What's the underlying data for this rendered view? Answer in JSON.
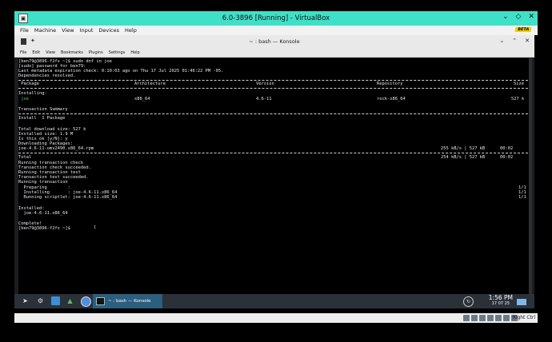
{
  "vbox": {
    "title": "6.0-3896 [Running] - VirtualBox",
    "menu": [
      "File",
      "Machine",
      "View",
      "Input",
      "Devices",
      "Help"
    ],
    "beta": "BETA",
    "host_key": "Right Ctrl"
  },
  "konsole": {
    "title": "~ : bash — Konsole",
    "menu": [
      "File",
      "Edit",
      "View",
      "Bookmarks",
      "Plugins",
      "Settings",
      "Help"
    ]
  },
  "terminal": {
    "lines": [
      "[ben79@3896-f2fs ~]$ sudo dnf in joe",
      "[sudo] password for ben79:",
      "Last metadata expiration check: 0:10:03 ago on Thu 17 Jul 2025 01:46:22 PM -05.",
      "Dependencies resolved."
    ],
    "table_header": {
      "package": " Package",
      "architecture": "Architecture",
      "version": "Version",
      "repository": "Repository",
      "size": "Size"
    },
    "installing_label": "Installing:",
    "package_row": {
      "name": " joe",
      "arch": "x86_64",
      "version": "4.6-11",
      "repo": "rock-x86_64",
      "size": "527 k"
    },
    "summary_title": "Transaction Summary",
    "install_line": "Install  1 Package",
    "lines2": [
      "Total download size: 527 k",
      "Installed size: 1.9 M",
      "Is this ok [y/N]: y",
      "Downloading Packages:"
    ],
    "download_row": {
      "file": "joe-4.6-11-omv2490.x86_64.rpm",
      "rate": "255 kB/s | 527 kB",
      "time": "00:02"
    },
    "total_row": {
      "label": "Total",
      "rate": "254 kB/s | 527 kB",
      "time": "00:02"
    },
    "lines3": [
      "Running transaction check",
      "Transaction check succeeded.",
      "Running transaction test",
      "Transaction test succeeded.",
      "Running transaction"
    ],
    "steps": [
      {
        "text": "  Preparing        :",
        "count": "1/1"
      },
      {
        "text": "  Installing       : joe-4.6-11.x86_64",
        "count": "1/1"
      },
      {
        "text": "  Running scriptlet: joe-4.6-11.x86_64",
        "count": "1/1"
      }
    ],
    "installed_label": "Installed:",
    "installed_pkg": "  joe-4.6-11.x86_64",
    "complete": "Complete!",
    "prompt": "[ben79@3896-f2fs ~]$"
  },
  "taskbar": {
    "task_label": "~ : bash — Konsole",
    "time": "1:56 PM",
    "date": "17 07 25"
  }
}
